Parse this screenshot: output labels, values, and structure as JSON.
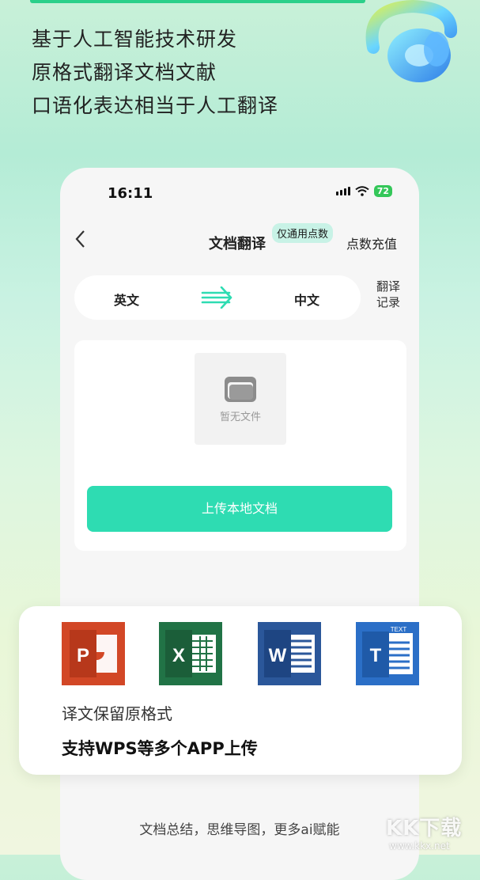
{
  "headlines": [
    "基于人工智能技术研发",
    "原格式翻译文档文献",
    "口语化表达相当于人工翻译"
  ],
  "status": {
    "time": "16:11",
    "battery": "72"
  },
  "nav": {
    "title": "文档翻译",
    "badge": "仅通用点数",
    "right_action": "点数充值"
  },
  "lang": {
    "source": "英文",
    "target": "中文",
    "history": "翻译记录"
  },
  "upload": {
    "empty_text": "暂无文件",
    "button": "上传本地文档"
  },
  "footer": {
    "text": "文档总结，思维导图，更多ai赋能"
  },
  "overlay": {
    "apps": [
      "powerpoint-icon",
      "excel-icon",
      "word-icon",
      "text-icon"
    ],
    "sub_text": "译文保留原格式",
    "main_text": "支持WPS等多个APP上传"
  },
  "watermark": {
    "main": "KK下载",
    "url": "www.kkx.net"
  },
  "colors": {
    "accent": "#2edcb2",
    "brand_green": "#2bd08a"
  }
}
